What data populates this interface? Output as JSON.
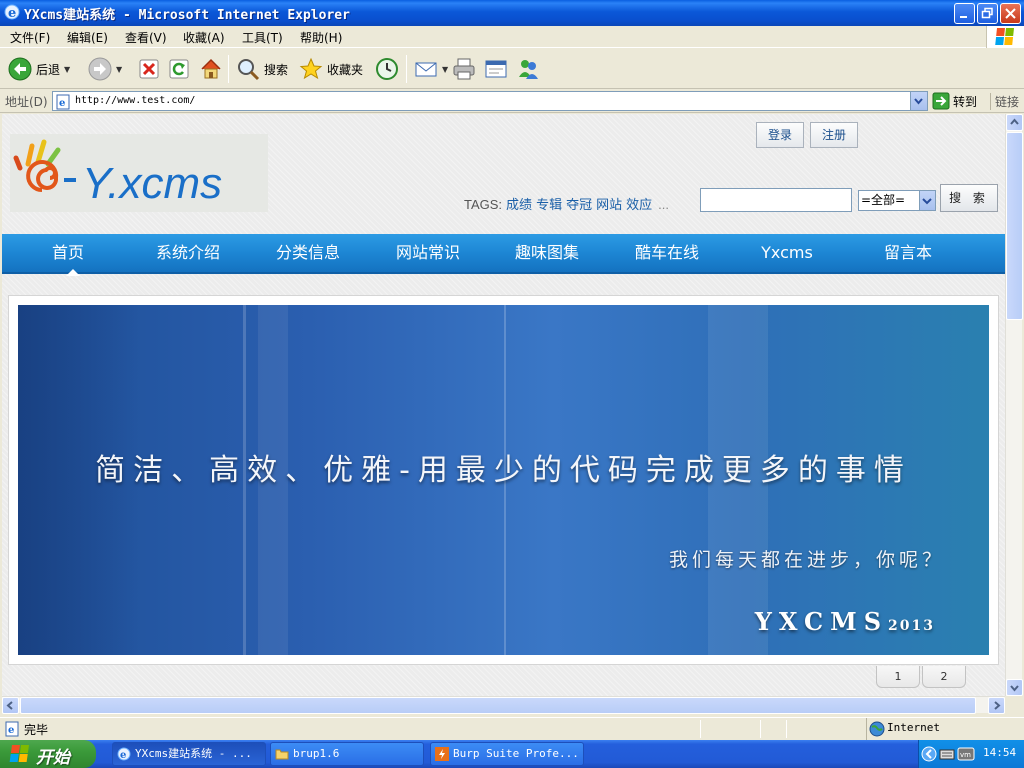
{
  "window": {
    "title": "YXcms建站系统 - Microsoft Internet Explorer"
  },
  "menu": [
    "文件(F)",
    "编辑(E)",
    "查看(V)",
    "收藏(A)",
    "工具(T)",
    "帮助(H)"
  ],
  "toolbar": {
    "back_label": "后退",
    "search_label": "搜索",
    "favorites_label": "收藏夹"
  },
  "address": {
    "label": "地址(D)",
    "url": "http://www.test.com/",
    "go_label": "转到",
    "links_label": "链接"
  },
  "site": {
    "login_label": "登录",
    "register_label": "注册",
    "tags_label": "TAGS:",
    "tags": [
      "成绩",
      "专辑",
      "夺冠",
      "网站",
      "效应"
    ],
    "tags_more": "...",
    "search_scope": "=全部=",
    "search_button": "搜 索",
    "nav": [
      "首页",
      "系统介绍",
      "分类信息",
      "网站常识",
      "趣味图集",
      "酷车在线",
      "Yxcms",
      "留言本"
    ],
    "banner": {
      "slogan": "简洁、高效、优雅-用最少的代码完成更多的事情",
      "subline": "我们每天都在进步，你呢？",
      "brand": "YXCMS",
      "brand_year": "2013"
    },
    "pager": [
      "1",
      "2"
    ]
  },
  "status": {
    "text": "完毕",
    "zone": "Internet"
  },
  "taskbar": {
    "start_label": "开始",
    "tasks": [
      "YXcms建站系统 - ...",
      "brup1.6",
      "Burp Suite Profe..."
    ],
    "clock": "14:54"
  }
}
